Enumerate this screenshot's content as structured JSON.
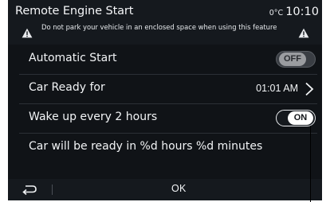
{
  "header": {
    "title": "Remote Engine Start",
    "temperature": "0°C",
    "clock": "10:10",
    "warning_text": "Do not park your vehicle in an enclosed space when using this feature"
  },
  "settings": {
    "automatic_start": {
      "label": "Automatic Start",
      "toggle_label": "OFF",
      "state": "off"
    },
    "car_ready_for": {
      "label": "Car Ready for",
      "value": "01:01 AM"
    },
    "wake_up": {
      "label": "Wake up every 2 hours",
      "toggle_label": "ON",
      "state": "on"
    },
    "info": {
      "label": "Car will be ready in %d hours %d minutes"
    }
  },
  "bottombar": {
    "ok_label": "OK"
  },
  "icons": {
    "warning": "warning-triangle-icon",
    "chevron": "chevron-right-icon",
    "back": "back-arrow-icon"
  },
  "colors": {
    "background": "#101317",
    "text": "#f2f4f6",
    "toggle_off": "#9a9ca0",
    "toggle_on": "#ffffff"
  }
}
